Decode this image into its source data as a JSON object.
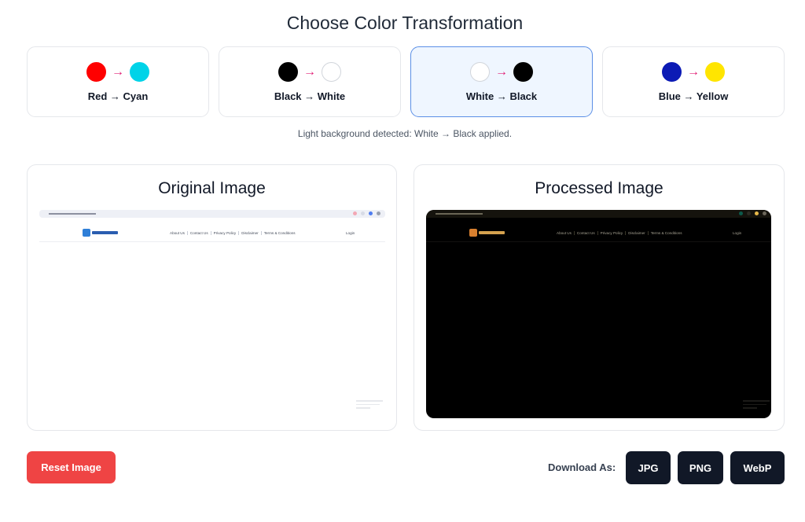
{
  "page": {
    "title": "Choose Color Transformation"
  },
  "transformations": [
    {
      "label": "Red → Cyan",
      "arrow": "→",
      "from_color": "#ff0000",
      "to_color": "#00d3e8",
      "border_from": "#ff0000",
      "border_to": "#00d3e8",
      "selected": false
    },
    {
      "label": "Black → White",
      "arrow": "→",
      "from_color": "#000000",
      "to_color": "#ffffff",
      "border_from": "#000000",
      "border_to": "#d1d5db",
      "selected": false
    },
    {
      "label": "White → Black",
      "arrow": "→",
      "from_color": "#ffffff",
      "to_color": "#000000",
      "border_from": "#d1d5db",
      "border_to": "#000000",
      "selected": true
    },
    {
      "label": "Blue → Yellow",
      "arrow": "→",
      "from_color": "#0c1bb5",
      "to_color": "#ffe500",
      "border_from": "#0c1bb5",
      "border_to": "#ffe500",
      "selected": false
    }
  ],
  "status": "Light background detected: White → Black applied.",
  "original": {
    "title": "Original Image",
    "nav": [
      "About Us",
      "Contact Us",
      "Privacy Policy",
      "Disclaimer",
      "Terms & Conditions"
    ],
    "login": "Login"
  },
  "processed": {
    "title": "Processed Image",
    "nav": [
      "About Us",
      "Contact Us",
      "Privacy Policy",
      "Disclaimer",
      "Terms & Conditions"
    ],
    "login": "Login"
  },
  "actions": {
    "reset_label": "Reset Image",
    "download_label": "Download As:",
    "formats": [
      "JPG",
      "PNG",
      "WebP"
    ]
  },
  "colors": {
    "accent_arrow": "#e11d74",
    "selected_bg": "#eff6ff",
    "selected_border": "#5b8fe6",
    "reset": "#ef4444",
    "download": "#111827",
    "orig_bar_icons": [
      "#f3a7b4",
      "#d7dbe6",
      "#4f7df0",
      "#9aa0ae"
    ],
    "proc_bar_icons": [
      "#0c5a4b",
      "#2c2a22",
      "#e6b84a",
      "#6b665a"
    ]
  }
}
